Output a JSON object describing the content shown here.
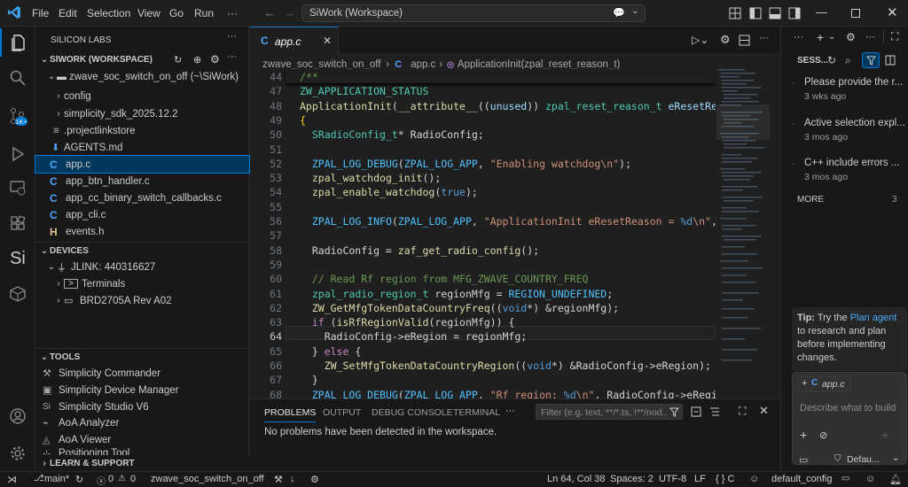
{
  "title_bar": {
    "menus": [
      "File",
      "Edit",
      "Selection",
      "View",
      "Go",
      "Run",
      "···"
    ],
    "search_text": "SiWork (Workspace)"
  },
  "sidebar": {
    "header": "SILICON LABS",
    "workspace_label": "SIWORK (WORKSPACE)",
    "project_folder": "zwave_soc_switch_on_off (~\\SiWork)",
    "tree_items": [
      "config",
      "simplicity_sdk_2025.12.2",
      ".projectlinkstore",
      "AGENTS.md",
      "app.c",
      "app_btn_handler.c",
      "app_cc_binary_switch_callbacks.c",
      "app_cli.c",
      "events.h"
    ],
    "devices_label": "DEVICES",
    "device_items": [
      "JLINK: 440316627",
      "Terminals",
      "BRD2705A Rev A02"
    ],
    "tools_label": "TOOLS",
    "tool_items": [
      "Simplicity Commander",
      "Simplicity Device Manager",
      "Simplicity Studio V6",
      "AoA Analyzer",
      "AoA Viewer",
      "Positioning Tool"
    ],
    "learn_label": "LEARN & SUPPORT"
  },
  "editor": {
    "tab_label": "app.c",
    "breadcrumb": [
      "zwave_soc_switch_on_off",
      "app.c",
      "ApplicationInit(zpal_reset_reason_t)"
    ],
    "line_numbers": [
      "44",
      "47",
      "48",
      "49",
      "50",
      "51",
      "52",
      "53",
      "54",
      "55",
      "56",
      "57",
      "58",
      "59",
      "60",
      "61",
      "62",
      "63",
      "64",
      "65",
      "66",
      "67",
      "68"
    ],
    "code": [
      [
        [
          "/**",
          "cm"
        ]
      ],
      [
        [
          "ZW_APPLICATION_STATUS",
          "ty"
        ]
      ],
      [
        [
          "ApplicationInit",
          "fn"
        ],
        [
          "(",
          "pl"
        ],
        [
          "__attribute__",
          "fn"
        ],
        [
          "((",
          "pl"
        ],
        [
          "unused",
          "vr"
        ],
        [
          "))",
          "pl"
        ],
        [
          " zpal_reset_reason_t ",
          "ty"
        ],
        [
          "eResetReason",
          "vr"
        ],
        [
          ")",
          "pl"
        ]
      ],
      [
        [
          "{",
          "yl"
        ]
      ],
      [
        [
          "  ",
          "pl"
        ],
        [
          "SRadioConfig_t",
          "ty"
        ],
        [
          "* RadioConfig;",
          "pl"
        ]
      ],
      [
        [
          "",
          "pl"
        ]
      ],
      [
        [
          "  ",
          "pl"
        ],
        [
          "ZPAL_LOG_DEBUG",
          "mc"
        ],
        [
          "(",
          "pl"
        ],
        [
          "ZPAL_LOG_APP",
          "mc"
        ],
        [
          ", ",
          "pl"
        ],
        [
          "\"Enabling watchdog\\n\"",
          "st"
        ],
        [
          ");",
          "pl"
        ]
      ],
      [
        [
          "  ",
          "pl"
        ],
        [
          "zpal_watchdog_init",
          "fn"
        ],
        [
          "();",
          "pl"
        ]
      ],
      [
        [
          "  ",
          "pl"
        ],
        [
          "zpal_enable_watchdog",
          "fn"
        ],
        [
          "(",
          "pl"
        ],
        [
          "true",
          "bl"
        ],
        [
          ");",
          "pl"
        ]
      ],
      [
        [
          "",
          "pl"
        ]
      ],
      [
        [
          "  ",
          "pl"
        ],
        [
          "ZPAL_LOG_INFO",
          "mc"
        ],
        [
          "(",
          "pl"
        ],
        [
          "ZPAL_LOG_APP",
          "mc"
        ],
        [
          ", ",
          "pl"
        ],
        [
          "\"ApplicationInit eResetReason = ",
          "st"
        ],
        [
          "%d",
          "bl"
        ],
        [
          "\\n\"",
          "st"
        ],
        [
          ", eResetReason);",
          "pl"
        ]
      ],
      [
        [
          "",
          "pl"
        ]
      ],
      [
        [
          "  RadioConfig = ",
          "pl"
        ],
        [
          "zaf_get_radio_config",
          "fn"
        ],
        [
          "();",
          "pl"
        ]
      ],
      [
        [
          "",
          "pl"
        ]
      ],
      [
        [
          "  ",
          "pl"
        ],
        [
          "// Read Rf region from MFG_ZWAVE_COUNTRY_FREQ",
          "cm"
        ]
      ],
      [
        [
          "  ",
          "pl"
        ],
        [
          "zpal_radio_region_t",
          "ty"
        ],
        [
          " regionMfg = ",
          "pl"
        ],
        [
          "REGION_UNDEFINED",
          "mc"
        ],
        [
          ";",
          "pl"
        ]
      ],
      [
        [
          "  ",
          "pl"
        ],
        [
          "ZW_GetMfgTokenDataCountryFreq",
          "fn"
        ],
        [
          "((",
          "pl"
        ],
        [
          "void",
          "bl"
        ],
        [
          "*) &regionMfg);",
          "pl"
        ]
      ],
      [
        [
          "  ",
          "pl"
        ],
        [
          "if",
          "kw"
        ],
        [
          " (",
          "pl"
        ],
        [
          "isRfRegionValid",
          "fn"
        ],
        [
          "(regionMfg)) {",
          "pl"
        ]
      ],
      [
        [
          "    RadioConfig->eRegion = regionMfg;",
          "pl"
        ]
      ],
      [
        [
          "  } ",
          "pl"
        ],
        [
          "else",
          "kw"
        ],
        [
          " {",
          "pl"
        ]
      ],
      [
        [
          "    ",
          "pl"
        ],
        [
          "ZW_SetMfgTokenDataCountryRegion",
          "fn"
        ],
        [
          "((",
          "pl"
        ],
        [
          "void",
          "bl"
        ],
        [
          "*) &RadioConfig->eRegion);",
          "pl"
        ]
      ],
      [
        [
          "  }",
          "pl"
        ]
      ],
      [
        [
          "  ",
          "pl"
        ],
        [
          "ZPAL_LOG_DEBUG",
          "mc"
        ],
        [
          "(",
          "pl"
        ],
        [
          "ZPAL_LOG_APP",
          "mc"
        ],
        [
          ", ",
          "pl"
        ],
        [
          "\"Rf region: ",
          "st"
        ],
        [
          "%d",
          "bl"
        ],
        [
          "\\n\"",
          "st"
        ],
        [
          ", RadioConfig->eRegion);",
          "pl"
        ]
      ]
    ]
  },
  "panel": {
    "tabs": [
      "PROBLEMS",
      "OUTPUT",
      "DEBUG CONSOLE",
      "TERMINAL",
      "···"
    ],
    "filter_placeholder": "Filter (e.g. text, **/*.ts, !**/nod...",
    "message": "No problems have been detected in the workspace."
  },
  "chat": {
    "header": "SESS...",
    "sessions": [
      {
        "title": "Please provide the r...",
        "time": "3 wks ago"
      },
      {
        "title": "Active selection expl...",
        "time": "3 mos ago"
      },
      {
        "title": "C++ include errors ...",
        "time": "3 mos ago"
      }
    ],
    "more_label": "MORE",
    "more_count": "3",
    "tip_label": "Tip:",
    "tip_pre": "Try the",
    "tip_link": "Plan agent",
    "tip_post": "to research and plan before implementing changes.",
    "context_file": "app.c",
    "input_placeholder": "Describe what to build",
    "mode_label": "Defau..."
  },
  "status": {
    "branch": "main*",
    "errors": "0",
    "warnings": "0",
    "project": "zwave_soc_switch_on_off",
    "position": "Ln 64, Col 38",
    "spaces": "Spaces: 2",
    "encoding": "UTF-8",
    "eol": "LF",
    "language": "{ } C",
    "config": "default_config"
  },
  "colors": {
    "accent": "#0078d4",
    "link": "#4daafc",
    "c_icon": "#4fa4ff",
    "h_icon": "#e2c08d"
  }
}
